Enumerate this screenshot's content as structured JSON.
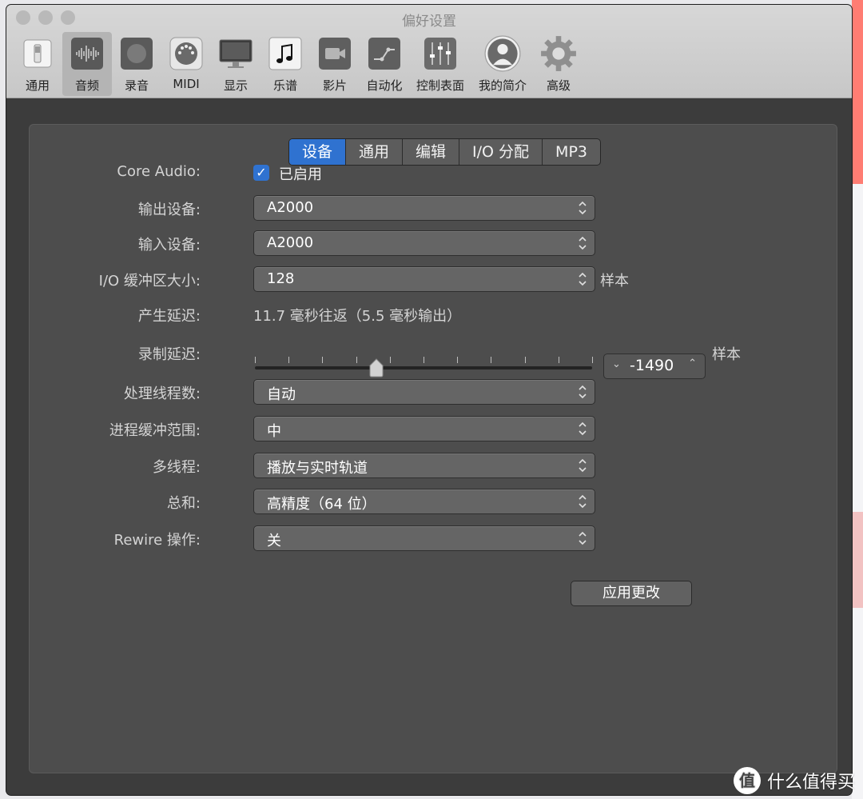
{
  "window": {
    "title": "偏好设置"
  },
  "toolbar": {
    "items": [
      {
        "label": "通用",
        "icon": "switch-icon"
      },
      {
        "label": "音频",
        "icon": "waveform-icon",
        "active": true
      },
      {
        "label": "录音",
        "icon": "record-icon"
      },
      {
        "label": "MIDI",
        "icon": "midi-port-icon"
      },
      {
        "label": "显示",
        "icon": "monitor-icon"
      },
      {
        "label": "乐谱",
        "icon": "music-note-icon"
      },
      {
        "label": "影片",
        "icon": "video-camera-icon"
      },
      {
        "label": "自动化",
        "icon": "automation-icon"
      },
      {
        "label": "控制表面",
        "icon": "faders-icon"
      },
      {
        "label": "我的简介",
        "icon": "user-silhouette-icon"
      },
      {
        "label": "高级",
        "icon": "gear-icon"
      }
    ]
  },
  "tabs": [
    {
      "label": "设备",
      "active": true
    },
    {
      "label": "通用"
    },
    {
      "label": "编辑"
    },
    {
      "label": "I/O 分配"
    },
    {
      "label": "MP3"
    }
  ],
  "form": {
    "core_audio": {
      "label": "Core Audio:",
      "checkbox_label": "已启用",
      "checked": true
    },
    "output_device": {
      "label": "输出设备:",
      "value": "A2000"
    },
    "input_device": {
      "label": "输入设备:",
      "value": "A2000"
    },
    "io_buffer": {
      "label": "I/O 缓冲区大小:",
      "value": "128",
      "unit": "样本"
    },
    "latency": {
      "label": "产生延迟:",
      "value": "11.7 毫秒往返（5.5 毫秒输出）"
    },
    "record_delay": {
      "label": "录制延迟:",
      "value": "-1490",
      "unit": "样本",
      "slider_fraction": 0.36
    },
    "threads": {
      "label": "处理线程数:",
      "value": "自动"
    },
    "process_buffer": {
      "label": "进程缓冲范围:",
      "value": "中"
    },
    "multithreading": {
      "label": "多线程:",
      "value": "播放与实时轨道"
    },
    "summing": {
      "label": "总和:",
      "value": "高精度（64 位）"
    },
    "rewire": {
      "label": "Rewire 操作:",
      "value": "关"
    }
  },
  "apply_button": {
    "label": "应用更改"
  },
  "watermark": {
    "badge": "值",
    "text": "什么值得买"
  },
  "colors": {
    "accent": "#2f72d0",
    "panel": "#4d4d4d",
    "toolbar": "#cfcfcf"
  }
}
